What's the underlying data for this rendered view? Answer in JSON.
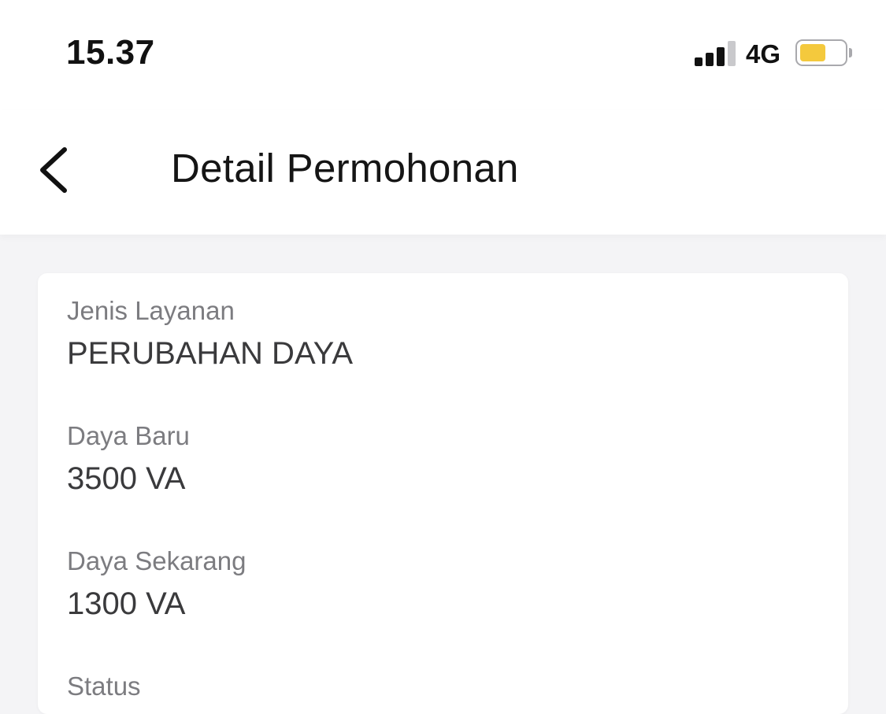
{
  "status_bar": {
    "time": "15.37",
    "network": "4G",
    "signal_icon": "signal-bars-icon",
    "battery_icon": "battery-icon",
    "battery_level": 0.55,
    "battery_color": "#f4c93d"
  },
  "header": {
    "back_icon": "chevron-left-icon",
    "title": "Detail Permohonan"
  },
  "details": [
    {
      "label": "Jenis Layanan",
      "value": "PERUBAHAN DAYA"
    },
    {
      "label": "Daya Baru",
      "value": "3500 VA"
    },
    {
      "label": "Daya Sekarang",
      "value": "1300 VA"
    },
    {
      "label": "Status",
      "value": ""
    }
  ],
  "colors": {
    "background": "#f4f4f6",
    "card": "#ffffff",
    "label_text": "#7c7c80",
    "value_text": "#3a3a3c"
  }
}
